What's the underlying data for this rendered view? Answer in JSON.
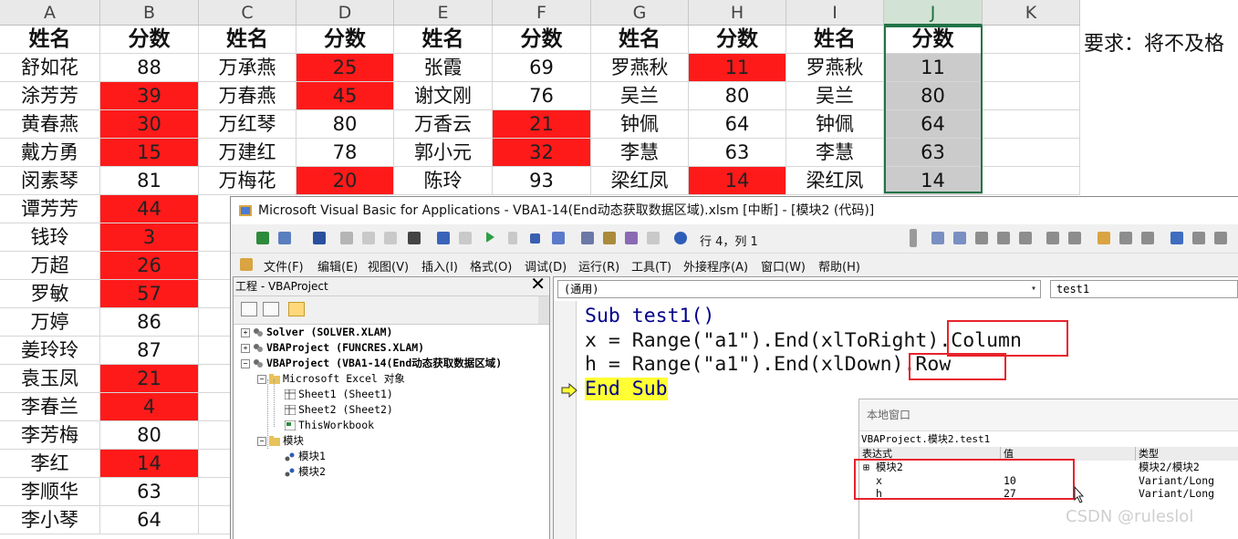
{
  "sheet": {
    "columns": [
      "A",
      "B",
      "C",
      "D",
      "E",
      "F",
      "G",
      "H",
      "I",
      "J",
      "K"
    ],
    "header_name": "姓名",
    "header_score": "分数",
    "note": "要求：将不及格",
    "rows": [
      [
        "舒如花",
        "88",
        "万承燕",
        "25",
        "张霞",
        "69",
        "罗燕秋",
        "11",
        "罗燕秋",
        "11"
      ],
      [
        "涂芳芳",
        "39",
        "万春燕",
        "45",
        "谢文刚",
        "76",
        "吴兰",
        "80",
        "吴兰",
        "80"
      ],
      [
        "黄春燕",
        "30",
        "万红琴",
        "80",
        "万香云",
        "21",
        "钟佩",
        "64",
        "钟佩",
        "64"
      ],
      [
        "戴方勇",
        "15",
        "万建红",
        "78",
        "郭小元",
        "32",
        "李慧",
        "63",
        "李慧",
        "63"
      ],
      [
        "闵素琴",
        "81",
        "万梅花",
        "20",
        "陈玲",
        "93",
        "梁红凤",
        "14",
        "梁红凤",
        "14"
      ],
      [
        "谭芳芳",
        "44",
        "万"
      ],
      [
        "钱玲",
        "3",
        "万"
      ],
      [
        "万超",
        "26",
        ""
      ],
      [
        "罗敏",
        "57",
        "王"
      ],
      [
        "万婷",
        "86",
        ""
      ],
      [
        "姜玲玲",
        "87",
        "魏"
      ],
      [
        "袁玉凤",
        "21",
        ""
      ],
      [
        "李春兰",
        "4",
        "吴"
      ],
      [
        "李芳梅",
        "80",
        "吴"
      ],
      [
        "李红",
        "14",
        "熊"
      ],
      [
        "李顺华",
        "63",
        "喻"
      ],
      [
        "李小琴",
        "64",
        "喻"
      ]
    ]
  },
  "vbe": {
    "title": "Microsoft Visual Basic for Applications - VBA1-14(End动态获取数据区域).xlsm [中断] - [模块2 (代码)]",
    "position": "行 4，列 1",
    "menus": [
      "文件(F)",
      "编辑(E)",
      "视图(V)",
      "插入(I)",
      "格式(O)",
      "调试(D)",
      "运行(R)",
      "工具(T)",
      "外接程序(A)",
      "窗口(W)",
      "帮助(H)"
    ],
    "project": {
      "title": "工程 - VBAProject",
      "close": "✕",
      "nodes": [
        "Solver (SOLVER.XLAM)",
        "VBAProject (FUNCRES.XLAM)",
        "VBAProject (VBA1-14(End动态获取数据区域)",
        "Microsoft Excel 对象",
        "Sheet1 (Sheet1)",
        "Sheet2 (Sheet2)",
        "ThisWorkbook",
        "模块",
        "模块1",
        "模块2"
      ]
    },
    "code": {
      "object_combo": "(通用)",
      "proc_combo": "test1",
      "lines": [
        "Sub test1()",
        "x = Range(\"a1\").End(xlToRight).Column",
        "h = Range(\"a1\").End(xlDown).Row",
        "End Sub"
      ]
    },
    "locals": {
      "title": "本地窗口",
      "path": "VBAProject.模块2.test1",
      "headers": [
        "表达式",
        "值",
        "类型"
      ],
      "rows": [
        [
          "⊞ 模块2",
          "",
          "模块2/模块2"
        ],
        [
          "x",
          "10",
          "Variant/Long"
        ],
        [
          "h",
          "27",
          "Variant/Long"
        ]
      ]
    }
  },
  "watermark": "CSDN @ruleslol",
  "colors": {
    "red": "#ff1a1a",
    "gray": "#cbcbcb",
    "excel_green": "#217346",
    "annotation": "#e8222a",
    "highlight": "#ffff33"
  }
}
